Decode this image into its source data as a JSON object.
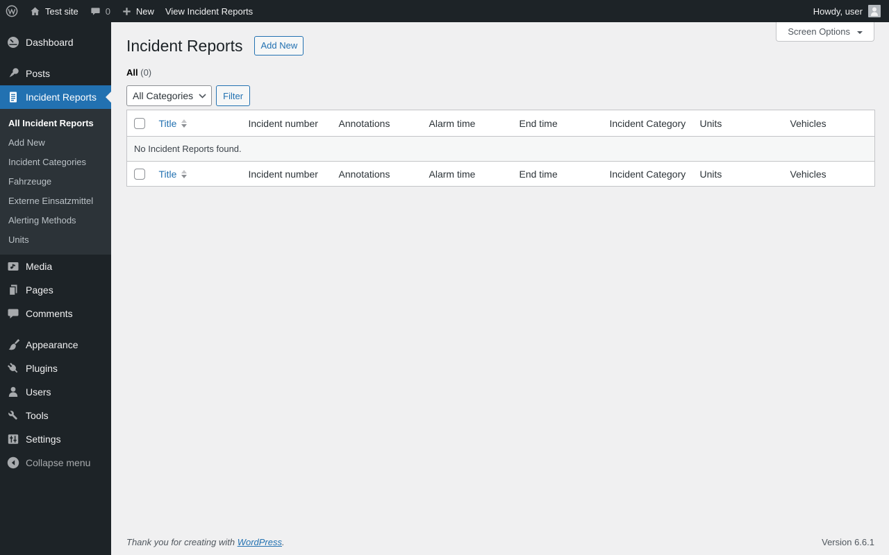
{
  "admin_bar": {
    "site_name": "Test site",
    "comments_count": "0",
    "new_label": "New",
    "view_link_label": "View Incident Reports",
    "howdy_label": "Howdy, user"
  },
  "sidebar": {
    "items": [
      {
        "label": "Dashboard"
      },
      {
        "label": "Posts"
      },
      {
        "label": "Incident Reports"
      },
      {
        "label": "Media"
      },
      {
        "label": "Pages"
      },
      {
        "label": "Comments"
      },
      {
        "label": "Appearance"
      },
      {
        "label": "Plugins"
      },
      {
        "label": "Users"
      },
      {
        "label": "Tools"
      },
      {
        "label": "Settings"
      }
    ],
    "submenu_items": [
      {
        "label": "All Incident Reports"
      },
      {
        "label": "Add New"
      },
      {
        "label": "Incident Categories"
      },
      {
        "label": "Fahrzeuge"
      },
      {
        "label": "Externe Einsatzmittel"
      },
      {
        "label": "Alerting Methods"
      },
      {
        "label": "Units"
      }
    ],
    "collapse_label": "Collapse menu"
  },
  "page": {
    "title": "Incident Reports",
    "add_new_label": "Add New",
    "screen_options_label": "Screen Options",
    "views_all_label": "All",
    "views_all_count": "(0)",
    "category_filter_value": "All Categories",
    "filter_button_label": "Filter"
  },
  "table": {
    "columns": [
      "Title",
      "Incident number",
      "Annotations",
      "Alarm time",
      "End time",
      "Incident Category",
      "Units",
      "Vehicles"
    ],
    "empty_message": "No Incident Reports found."
  },
  "footer": {
    "thankyou_text": "Thank you for creating with",
    "wordpress_link_label": "WordPress",
    "period": ".",
    "version": "Version 6.6.1"
  },
  "colors": {
    "admin_bar_bg": "#1d2327",
    "menu_active_bg": "#2271b1",
    "submenu_bg": "#2c3338",
    "content_bg": "#f0f0f1",
    "link": "#2271b1",
    "table_border": "#c3c4c7"
  }
}
